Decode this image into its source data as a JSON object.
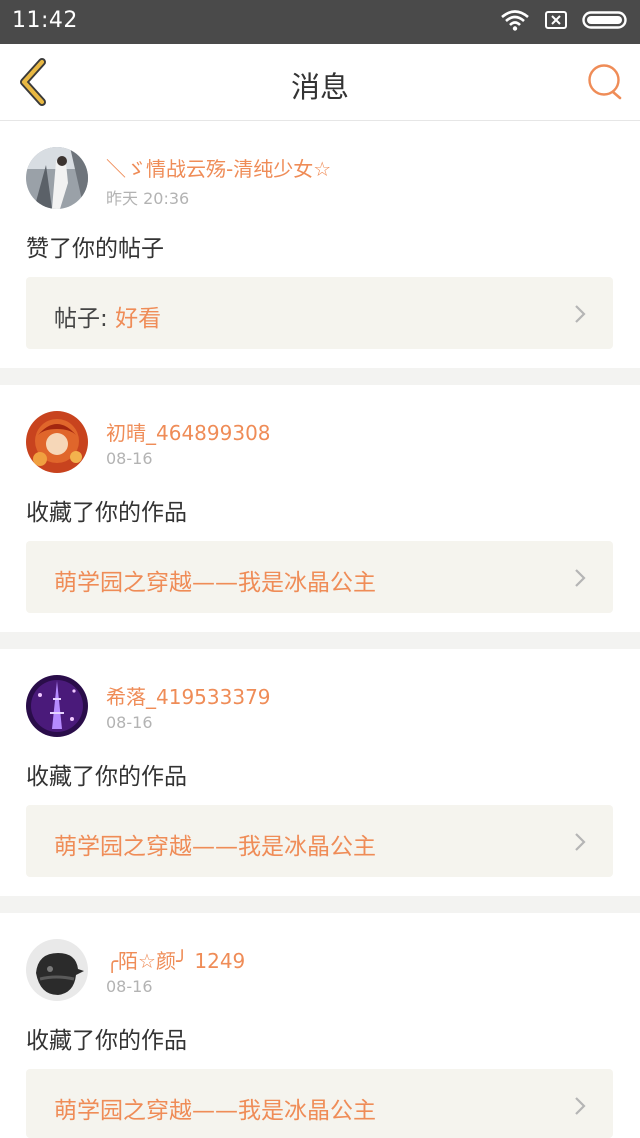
{
  "status_bar": {
    "time": "11:42"
  },
  "header": {
    "title": "消息"
  },
  "colors": {
    "accent": "#ef8c57",
    "back_arrow": "#e8b843",
    "ref_bg": "#f5f4ee"
  },
  "messages": [
    {
      "user": "＼ゞ情战云殇-清纯少女☆",
      "date": "昨天 20:36",
      "action": "赞了你的帖子",
      "ref_prefix": "帖子: ",
      "ref_title": "好看"
    },
    {
      "user": "初晴_464899308",
      "date": "08-16",
      "action": "收藏了你的作品",
      "ref_prefix": "",
      "ref_title": "萌学园之穿越——我是冰晶公主"
    },
    {
      "user": "希落_419533379",
      "date": "08-16",
      "action": "收藏了你的作品",
      "ref_prefix": "",
      "ref_title": "萌学园之穿越——我是冰晶公主"
    },
    {
      "user": "╭陌☆颜╯ 1249",
      "date": "08-16",
      "action": "收藏了你的作品",
      "ref_prefix": "",
      "ref_title": "萌学园之穿越——我是冰晶公主"
    }
  ]
}
